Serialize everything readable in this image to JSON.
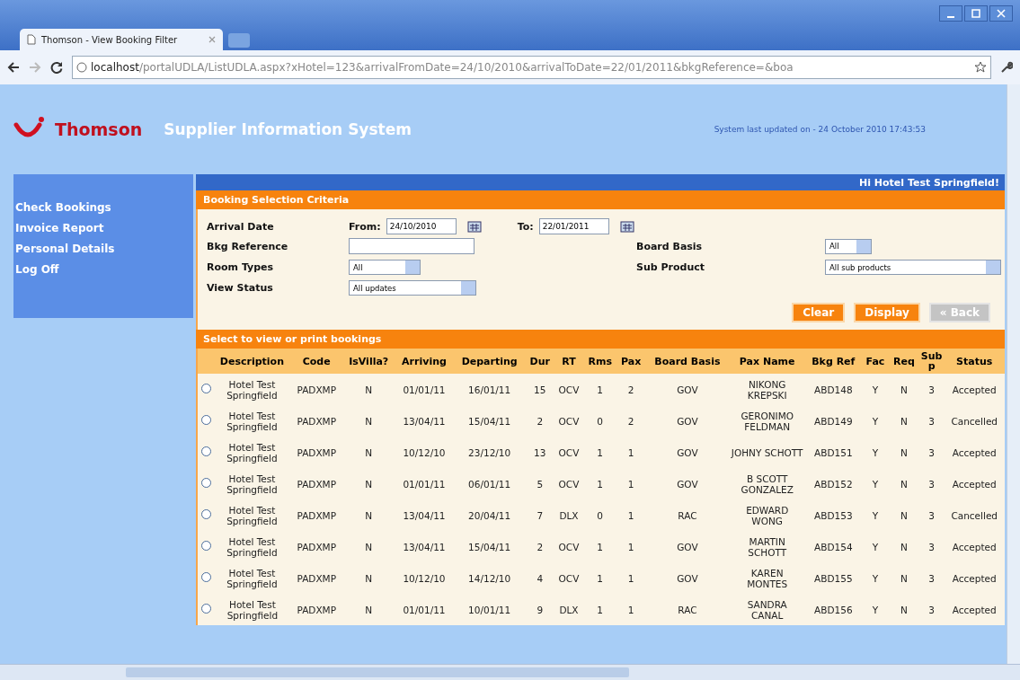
{
  "browser": {
    "tab_title": "Thomson - View Booking Filter",
    "url_host": "localhost",
    "url_path": "/portalUDLA/ListUDLA.aspx?xHotel=123&arrivalFromDate=24/10/2010&arrivalToDate=22/01/2011&bkgReference=&boa"
  },
  "header": {
    "brand": "Thomson",
    "title": "Supplier Information System",
    "updated": "System last updated on - 24 October 2010 17:43:53"
  },
  "greeting": "Hi Hotel Test Springfield!",
  "sidebar": {
    "items": [
      {
        "label": "Check Bookings"
      },
      {
        "label": "Invoice Report"
      },
      {
        "label": "Personal Details"
      },
      {
        "label": "Log Off"
      }
    ]
  },
  "criteria": {
    "title": "Booking Selection Criteria",
    "arrival": {
      "label": "Arrival Date",
      "from_label": "From:",
      "from_value": "24/10/2010",
      "to_label": "To:",
      "to_value": "22/01/2011"
    },
    "bkg_reference": {
      "label": "Bkg Reference"
    },
    "board_basis": {
      "label": "Board Basis",
      "value": "All"
    },
    "room_types": {
      "label": "Room Types",
      "value": "All"
    },
    "sub_product": {
      "label": "Sub Product",
      "value": "All sub products"
    },
    "view_status": {
      "label": "View Status",
      "value": "All updates"
    },
    "buttons": [
      {
        "label": "Clear",
        "disabled": false
      },
      {
        "label": "Display",
        "disabled": false
      },
      {
        "label": "« Back",
        "disabled": true
      }
    ]
  },
  "bookings": {
    "title": "Select to view or print bookings",
    "columns": [
      "Description",
      "Code",
      "IsVilla?",
      "Arriving",
      "Departing",
      "Dur",
      "RT",
      "Rms",
      "Pax",
      "Board Basis",
      "Pax Name",
      "Bkg Ref",
      "Fac",
      "Req",
      "Sub p",
      "Status"
    ],
    "rows": [
      {
        "selected": false,
        "cells": [
          "Hotel Test Springfield",
          "PADXMP",
          "N",
          "01/01/11",
          "16/01/11",
          "15",
          "OCV",
          "1",
          "2",
          "GOV",
          "NIKONG KREPSKI",
          "ABD148",
          "Y",
          "N",
          "3",
          "Accepted"
        ]
      },
      {
        "selected": false,
        "cells": [
          "Hotel Test Springfield",
          "PADXMP",
          "N",
          "13/04/11",
          "15/04/11",
          "2",
          "OCV",
          "0",
          "2",
          "GOV",
          "GERONIMO FELDMAN",
          "ABD149",
          "Y",
          "N",
          "3",
          "Cancelled"
        ]
      },
      {
        "selected": false,
        "cells": [
          "Hotel Test Springfield",
          "PADXMP",
          "N",
          "10/12/10",
          "23/12/10",
          "13",
          "OCV",
          "1",
          "1",
          "GOV",
          "JOHNY SCHOTT",
          "ABD151",
          "Y",
          "N",
          "3",
          "Accepted"
        ]
      },
      {
        "selected": false,
        "cells": [
          "Hotel Test Springfield",
          "PADXMP",
          "N",
          "01/01/11",
          "06/01/11",
          "5",
          "OCV",
          "1",
          "1",
          "GOV",
          "B SCOTT GONZALEZ",
          "ABD152",
          "Y",
          "N",
          "3",
          "Accepted"
        ]
      },
      {
        "selected": false,
        "cells": [
          "Hotel Test Springfield",
          "PADXMP",
          "N",
          "13/04/11",
          "20/04/11",
          "7",
          "DLX",
          "0",
          "1",
          "RAC",
          "EDWARD WONG",
          "ABD153",
          "Y",
          "N",
          "3",
          "Cancelled"
        ]
      },
      {
        "selected": false,
        "cells": [
          "Hotel Test Springfield",
          "PADXMP",
          "N",
          "13/04/11",
          "15/04/11",
          "2",
          "OCV",
          "1",
          "1",
          "GOV",
          "MARTIN SCHOTT",
          "ABD154",
          "Y",
          "N",
          "3",
          "Accepted"
        ]
      },
      {
        "selected": false,
        "cells": [
          "Hotel Test Springfield",
          "PADXMP",
          "N",
          "10/12/10",
          "14/12/10",
          "4",
          "OCV",
          "1",
          "1",
          "GOV",
          "KAREN MONTES",
          "ABD155",
          "Y",
          "N",
          "3",
          "Accepted"
        ]
      },
      {
        "selected": false,
        "cells": [
          "Hotel Test Springfield",
          "PADXMP",
          "N",
          "01/01/11",
          "10/01/11",
          "9",
          "DLX",
          "1",
          "1",
          "RAC",
          "SANDRA CANAL",
          "ABD156",
          "Y",
          "N",
          "3",
          "Accepted"
        ]
      }
    ]
  }
}
